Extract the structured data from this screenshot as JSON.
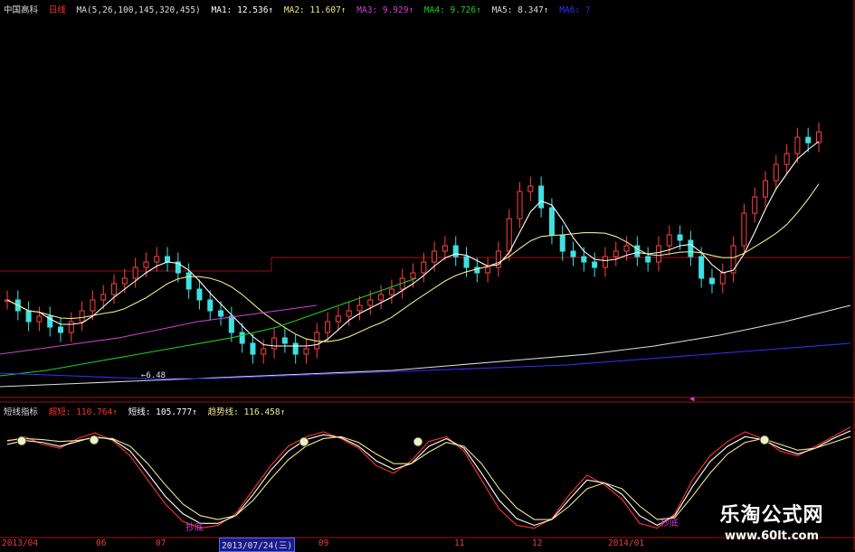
{
  "legend": {
    "name": "中国高科",
    "period": "日线",
    "ma_params": "MA(5,26,100,145,320,455)",
    "ma1": "MA1: 12.536↑",
    "ma2": "MA2: 11.607↑",
    "ma3": "MA3: 9.929↑",
    "ma4": "MA4: 9.726↑",
    "ma5": "MA5: 8.347↑",
    "ma6": "MA6: ?",
    "colors": {
      "name": "#dddddd",
      "period": "#ff3030",
      "ma1": "#ffffff",
      "ma2": "#f0e68c",
      "ma3": "#d040d0",
      "ma4": "#20d020",
      "ma5": "#dddddd",
      "ma6": "#3030ff"
    }
  },
  "sub_legend": {
    "name": "短线指标",
    "line1": "超短: 110.764↑",
    "line2": "短线: 105.777↑",
    "line3": "趋势线: 116.458↑",
    "colors": {
      "line1": "#ff3030",
      "line2": "#ffffff",
      "line3": "#f0e68c"
    }
  },
  "annotations": {
    "low_label": "←6.48",
    "bottom1": "抄底",
    "bottom2": "抄底"
  },
  "x_axis": {
    "ticks": [
      "2013/04",
      "06",
      "07",
      "2013/07/24(三)",
      "09",
      "11",
      "12",
      "2014/01"
    ]
  },
  "watermark": {
    "title": "乐淘公式网",
    "url": "www.60lt.com"
  },
  "chart_data": [
    {
      "type": "line",
      "note": "Price panel: candlestick chart with moving averages (values approximate)",
      "y_min": 6.0,
      "y_max": 16.0,
      "close": [
        9.6,
        9.2,
        8.8,
        9.0,
        8.6,
        8.4,
        8.8,
        9.2,
        9.6,
        9.8,
        10.2,
        10.4,
        10.8,
        11.0,
        11.2,
        11.0,
        10.6,
        10.0,
        9.6,
        9.2,
        9.0,
        8.4,
        8.0,
        7.6,
        7.8,
        8.2,
        8.0,
        7.6,
        7.8,
        8.4,
        8.8,
        9.0,
        9.2,
        9.4,
        9.6,
        9.8,
        10.0,
        10.4,
        10.6,
        11.0,
        11.4,
        11.6,
        11.2,
        10.8,
        10.6,
        10.8,
        11.4,
        12.6,
        13.6,
        13.8,
        13.0,
        12.0,
        11.4,
        11.2,
        11.0,
        10.8,
        11.2,
        11.4,
        11.6,
        11.2,
        11.0,
        11.6,
        12.0,
        11.8,
        11.2,
        10.4,
        10.2,
        10.6,
        11.6,
        12.8,
        13.4,
        14.0,
        14.6,
        15.0,
        15.6,
        15.4,
        15.8
      ],
      "series": [
        {
          "name": "MA1",
          "color": "#ffffff"
        },
        {
          "name": "MA2",
          "color": "#f0e68c"
        },
        {
          "name": "MA3",
          "color": "#d040d0",
          "values": [
            7.6,
            7.8,
            8.0,
            8.2,
            8.5,
            8.8,
            9.0,
            9.2,
            9.4
          ]
        },
        {
          "name": "MA4",
          "color": "#20d020",
          "values": [
            6.8,
            7.0,
            7.3,
            7.6,
            7.9,
            8.2,
            8.6,
            9.2,
            9.8,
            10.4
          ]
        },
        {
          "name": "MA5",
          "color": "#dddddd",
          "values": [
            6.4,
            6.5,
            6.6,
            6.7,
            6.8,
            6.9,
            7.0,
            7.2,
            7.4,
            7.6,
            7.9,
            8.3,
            8.8,
            9.4
          ]
        },
        {
          "name": "MA6",
          "color": "#3030ff",
          "values": [
            6.9,
            6.8,
            6.7,
            6.7,
            6.8,
            6.9,
            7.0,
            7.1,
            7.2,
            7.4,
            7.6,
            7.8,
            8.0
          ]
        }
      ]
    },
    {
      "type": "line",
      "note": "Oscillator panel (values approximate, 0-120 scale)",
      "y_min": 0,
      "y_max": 120,
      "series": [
        {
          "name": "超短",
          "color": "#ff3030",
          "values": [
            95,
            100,
            92,
            88,
            98,
            104,
            96,
            80,
            55,
            30,
            12,
            5,
            8,
            20,
            45,
            70,
            90,
            100,
            105,
            98,
            88,
            70,
            62,
            75,
            95,
            100,
            85,
            55,
            25,
            8,
            5,
            15,
            40,
            60,
            50,
            35,
            10,
            5,
            20,
            55,
            80,
            95,
            105,
            98,
            85,
            80,
            90,
            100,
            110
          ]
        },
        {
          "name": "短线",
          "color": "#ffffff",
          "values": [
            92,
            96,
            94,
            90,
            95,
            100,
            97,
            85,
            62,
            38,
            20,
            10,
            10,
            18,
            40,
            65,
            85,
            97,
            102,
            99,
            90,
            75,
            66,
            72,
            90,
            98,
            88,
            62,
            34,
            15,
            8,
            14,
            35,
            55,
            52,
            40,
            18,
            8,
            18,
            48,
            74,
            90,
            100,
            97,
            88,
            82,
            88,
            98,
            106
          ]
        },
        {
          "name": "趋势线",
          "color": "#f0e68c",
          "values": [
            96,
            98,
            97,
            95,
            96,
            99,
            98,
            90,
            72,
            50,
            30,
            18,
            14,
            18,
            34,
            56,
            76,
            90,
            98,
            100,
            94,
            82,
            72,
            72,
            84,
            94,
            90,
            72,
            46,
            26,
            14,
            14,
            28,
            46,
            52,
            46,
            28,
            14,
            16,
            38,
            62,
            82,
            94,
            98,
            92,
            86,
            88,
            94,
            100
          ]
        }
      ]
    }
  ]
}
